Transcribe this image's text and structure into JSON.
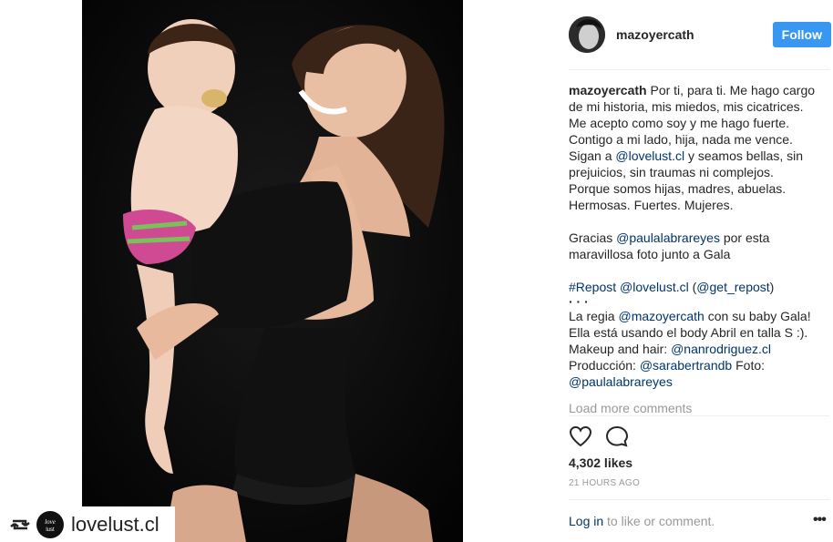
{
  "post": {
    "username": "mazoyercath",
    "follow_label": "Follow",
    "caption": {
      "lines_1": [
        "Por ti, para ti. Me hago cargo",
        "de mi historia, mis miedos, mis cicatrices.",
        "Me acepto como soy y me hago fuerte.",
        "Contigo a mi lado, hija, nada me vence."
      ],
      "l5_pre": "Sigan a ",
      "l5_link": "@lovelust.cl",
      "l5_post": " y seamos bellas, sin",
      "lines_2": [
        "prejuicios, sin traumas ni complejos.",
        "Porque somos hijas, madres, abuelas.",
        "Hermosas. Fuertes. Mujeres."
      ],
      "thanks_pre": "Gracias ",
      "thanks_link": "@paulalabrareyes",
      "thanks_post": " por esta",
      "thanks_l2": "maravillosa foto junto a Gala",
      "repost_tag": "#Repost",
      "repost_user": "@lovelust.cl",
      "repost_paren_open": " (",
      "repost_via": "@get_repost",
      "repost_paren_close": ")",
      "dots": "·  ·  ·",
      "regia_pre": "La regia ",
      "regia_link": "@mazoyercath",
      "regia_post": " con su baby Gala!",
      "body_line": "Ella está usando el body Abril en talla S :).",
      "makeup_pre": "Makeup and hair: ",
      "makeup_link": "@nanrodriguez.cl",
      "prod_pre": "Producción: ",
      "prod_link": "@sarabertrandb",
      "prod_post": " Foto:",
      "foto_link": "@paulalabrareyes"
    },
    "load_more": "Load more comments",
    "likes": "4,302 likes",
    "time": "21 HOURS AGO",
    "login_link": "Log in",
    "login_text": " to like or comment.",
    "more_dots": "•••"
  },
  "repost_badge": {
    "name": "lovelust.cl",
    "logo_text": "love lust"
  },
  "icons": [
    "repost-icon",
    "heart-icon",
    "comment-icon",
    "more-options-icon"
  ],
  "colors": {
    "accent": "#3897f0",
    "link": "#003569",
    "muted": "#999999"
  }
}
